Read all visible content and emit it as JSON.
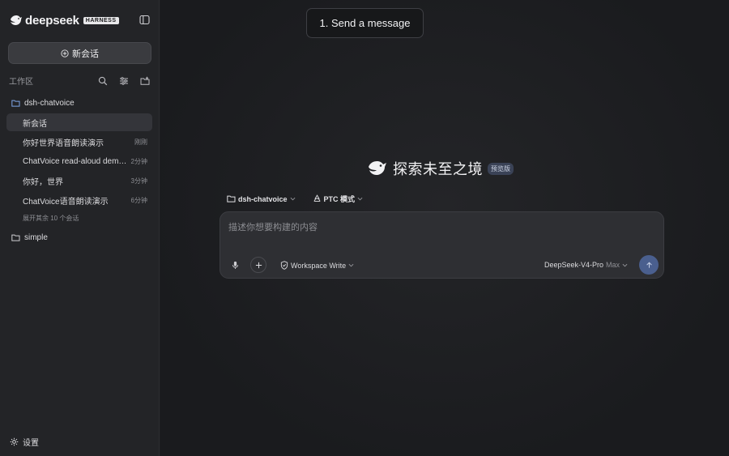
{
  "sidebar": {
    "brand": {
      "name": "deepseek",
      "badge": "HARNESS"
    },
    "new_chat_label": "新会话",
    "workspace_title": "工作区",
    "folders": [
      {
        "name": "dsh-chatvoice"
      },
      {
        "name": "simple"
      }
    ],
    "sessions": [
      {
        "title": "新会话",
        "time": "",
        "active": true
      },
      {
        "title": "你好世界语音朗读演示",
        "time": "刚刚"
      },
      {
        "title": "ChatVoice read-aloud demo...",
        "time": "2分钟"
      },
      {
        "title": "你好，世界",
        "time": "3分钟"
      },
      {
        "title": "ChatVoice语音朗读演示",
        "time": "6分钟"
      }
    ],
    "more_sessions": "展开其余 10 个会话",
    "settings_label": "设置"
  },
  "main": {
    "tooltip": "1. Send a message",
    "hero": {
      "title": "探索未至之境",
      "badge": "预览版"
    },
    "context": {
      "workspace": "dsh-chatvoice",
      "mode": "PTC 模式"
    },
    "composer": {
      "placeholder": "描述你想要构建的内容",
      "value": "",
      "permission": "Workspace Write",
      "model": "DeepSeek-V4-Pro",
      "effort": "Max"
    }
  },
  "colors": {
    "accent": "#4a5f8e",
    "sidebar_bg": "#232427",
    "active_item": "#34353a"
  }
}
